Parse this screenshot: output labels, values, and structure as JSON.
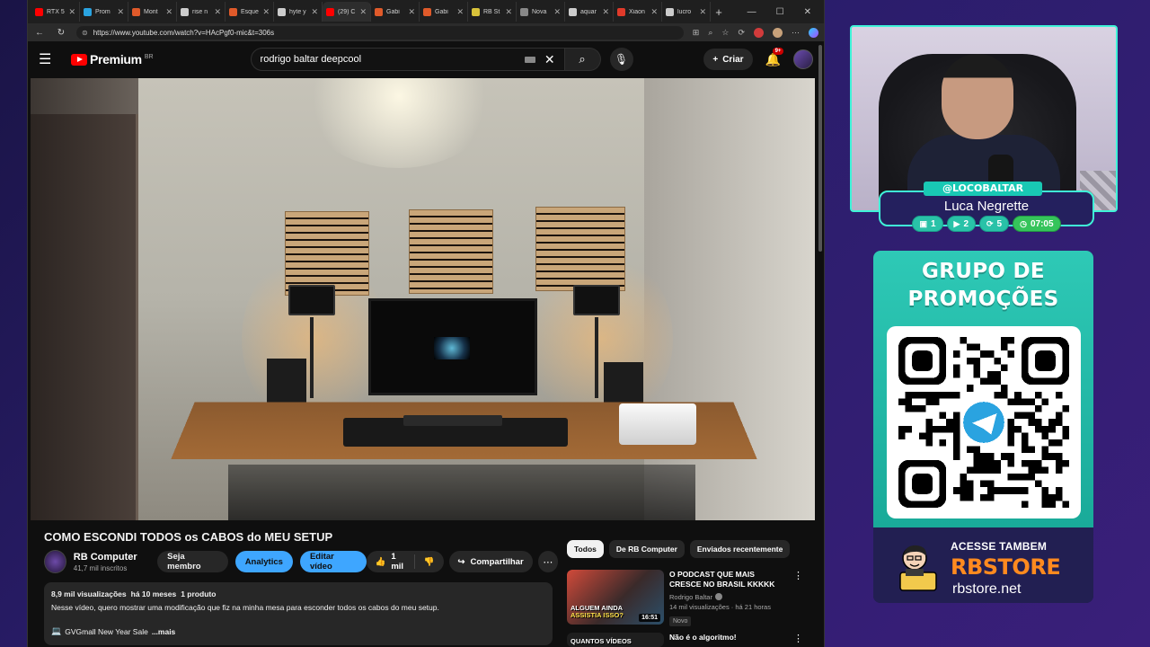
{
  "browser": {
    "tabs": [
      {
        "label": "RTX 5",
        "color": "#ff0000"
      },
      {
        "label": "Prom",
        "color": "#2aa3e0"
      },
      {
        "label": "Mont",
        "color": "#e05a2a"
      },
      {
        "label": "rise n",
        "color": "#cccccc"
      },
      {
        "label": "Esque",
        "color": "#e05a2a"
      },
      {
        "label": "hyte y",
        "color": "#cccccc"
      },
      {
        "label": "(29) C",
        "color": "#ff0000"
      },
      {
        "label": "Gabi",
        "color": "#e05a2a"
      },
      {
        "label": "Gabi",
        "color": "#e05a2a"
      },
      {
        "label": "RB St",
        "color": "#d8c23a"
      },
      {
        "label": "Nova",
        "color": "#888888"
      },
      {
        "label": "aquar",
        "color": "#cccccc"
      },
      {
        "label": "Xiaon",
        "color": "#e03a2a"
      },
      {
        "label": "lucro",
        "color": "#cccccc"
      }
    ],
    "active_tab_index": 6,
    "url": "https://www.youtube.com/watch?v=HAcPgf0-mic&t=306s"
  },
  "youtube": {
    "logo_word": "Premium",
    "region": "BR",
    "search_value": "rodrigo baltar deepcool",
    "create_label": "Criar",
    "notif_count": "9+",
    "video": {
      "title": "COMO ESCONDI TODOS os CABOS do MEU SETUP",
      "channel_name": "RB Computer",
      "subscribers": "41,7 mil inscritos",
      "join_label": "Seja membro",
      "analytics_label": "Analytics",
      "edit_label": "Editar vídeo",
      "likes": "1 mil",
      "share_label": "Compartilhar",
      "views": "8,9 mil visualizações",
      "age": "há 10 meses",
      "products": "1 produto",
      "description": "Nesse vídeo, quero mostrar uma modificação que fiz na minha mesa para esconder todos os cabos do meu setup.",
      "desc_line3": "GVGmall New Year Sale",
      "more_label": "...mais"
    },
    "chips": [
      "Todos",
      "De RB Computer",
      "Enviados recentemente"
    ],
    "related": [
      {
        "title": "O PODCAST QUE MAIS CRESCE NO BRASIL KKKKK",
        "channel": "Rodrigo Baltar",
        "meta": "14 mil visualizações · há 21 horas",
        "badge": "Novo",
        "duration": "16:51",
        "thumb_caption_1": "ALGUEM AINDA",
        "thumb_caption_2": "ASSISTIA ISSO?"
      },
      {
        "title": "Não é o algoritmo!",
        "thumb_caption_1": "QUANTOS VÍDEOS"
      }
    ]
  },
  "overlay": {
    "handle": "@LOCOBALTAR",
    "streamer_name": "Luca Negrette",
    "stats": [
      {
        "icon": "chat-icon",
        "value": "1"
      },
      {
        "icon": "video-icon",
        "value": "2"
      },
      {
        "icon": "sync-icon",
        "value": "5"
      },
      {
        "icon": "clock-icon",
        "value": "07:05"
      }
    ],
    "promo_title_1": "GRUPO DE",
    "promo_title_2": "PROMOÇÕES",
    "store_line1": "ACESSE TAMBEM",
    "store_line2": "RBSTORE",
    "store_line3": "rbstore.net"
  }
}
